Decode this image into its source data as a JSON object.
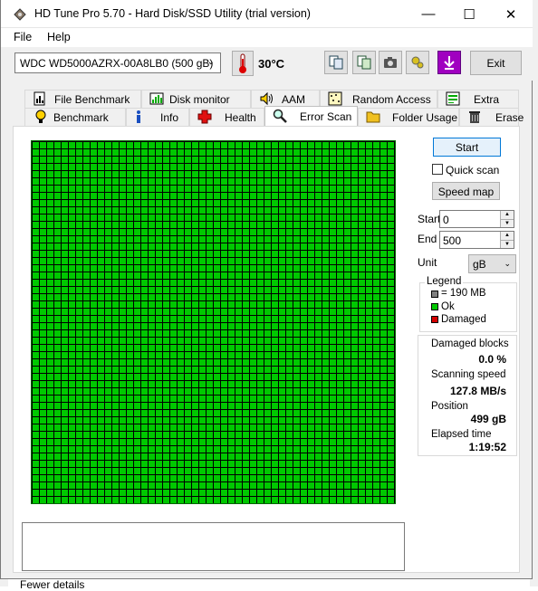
{
  "window": {
    "title": "HD Tune Pro 5.70 - Hard Disk/SSD Utility (trial version)"
  },
  "menu": {
    "file": "File",
    "help": "Help"
  },
  "toolbar": {
    "drive": "WDC WD5000AZRX-00A8LB0 (500 gB)",
    "temperature": "30°C",
    "exit_label": "Exit"
  },
  "tabs_row1": [
    {
      "label": "File Benchmark",
      "icon": "file-benchmark-icon"
    },
    {
      "label": "Disk monitor",
      "icon": "disk-monitor-icon"
    },
    {
      "label": "AAM",
      "icon": "speaker-icon"
    },
    {
      "label": "Random Access",
      "icon": "random-access-icon"
    },
    {
      "label": "Extra tests",
      "icon": "extra-tests-icon"
    }
  ],
  "tabs_row2": [
    {
      "label": "Benchmark",
      "icon": "benchmark-icon"
    },
    {
      "label": "Info",
      "icon": "info-icon"
    },
    {
      "label": "Health",
      "icon": "health-cross-icon"
    },
    {
      "label": "Error Scan",
      "icon": "magnifier-icon",
      "active": true
    },
    {
      "label": "Folder Usage",
      "icon": "folder-icon"
    },
    {
      "label": "Erase",
      "icon": "trash-icon"
    }
  ],
  "controls": {
    "start_label": "Start",
    "quick_scan_label": "Quick scan",
    "speed_map_label": "Speed map",
    "start_field_label": "Start",
    "start_value": "0",
    "end_field_label": "End",
    "end_value": "500",
    "unit_label": "Unit",
    "unit_value": "gB"
  },
  "legend": {
    "title": "Legend",
    "block_size": "= 190 MB",
    "ok": "Ok",
    "damaged": "Damaged",
    "colors": {
      "block": "#808080",
      "ok": "#00c800",
      "damaged": "#d40000"
    }
  },
  "stats": {
    "damaged_blocks_label": "Damaged blocks",
    "damaged_blocks_value": "0.0 %",
    "scanning_speed_label": "Scanning speed",
    "scanning_speed_value": "127.8 MB/s",
    "position_label": "Position",
    "position_value": "499 gB",
    "elapsed_label": "Elapsed time",
    "elapsed_value": "1:19:52"
  },
  "footer": {
    "fewer_details": "Fewer details"
  }
}
